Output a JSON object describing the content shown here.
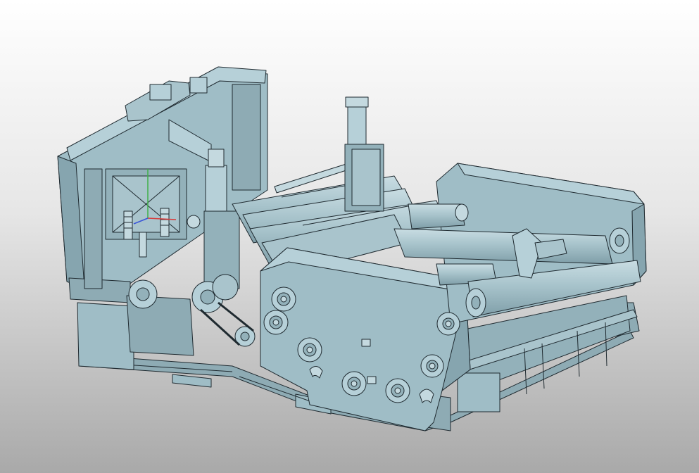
{
  "viewport": {
    "background_top": "#ffffff",
    "background_bottom": "#a9a9a9",
    "model_fill": "#9fbdc6",
    "model_fill_light": "#b6d0d8",
    "model_fill_dark": "#7f9ea8",
    "edge_color": "#1f2a30",
    "axis_colors": {
      "x": "#d93a3a",
      "y": "#3fb04a",
      "z": "#3a55d9"
    }
  }
}
